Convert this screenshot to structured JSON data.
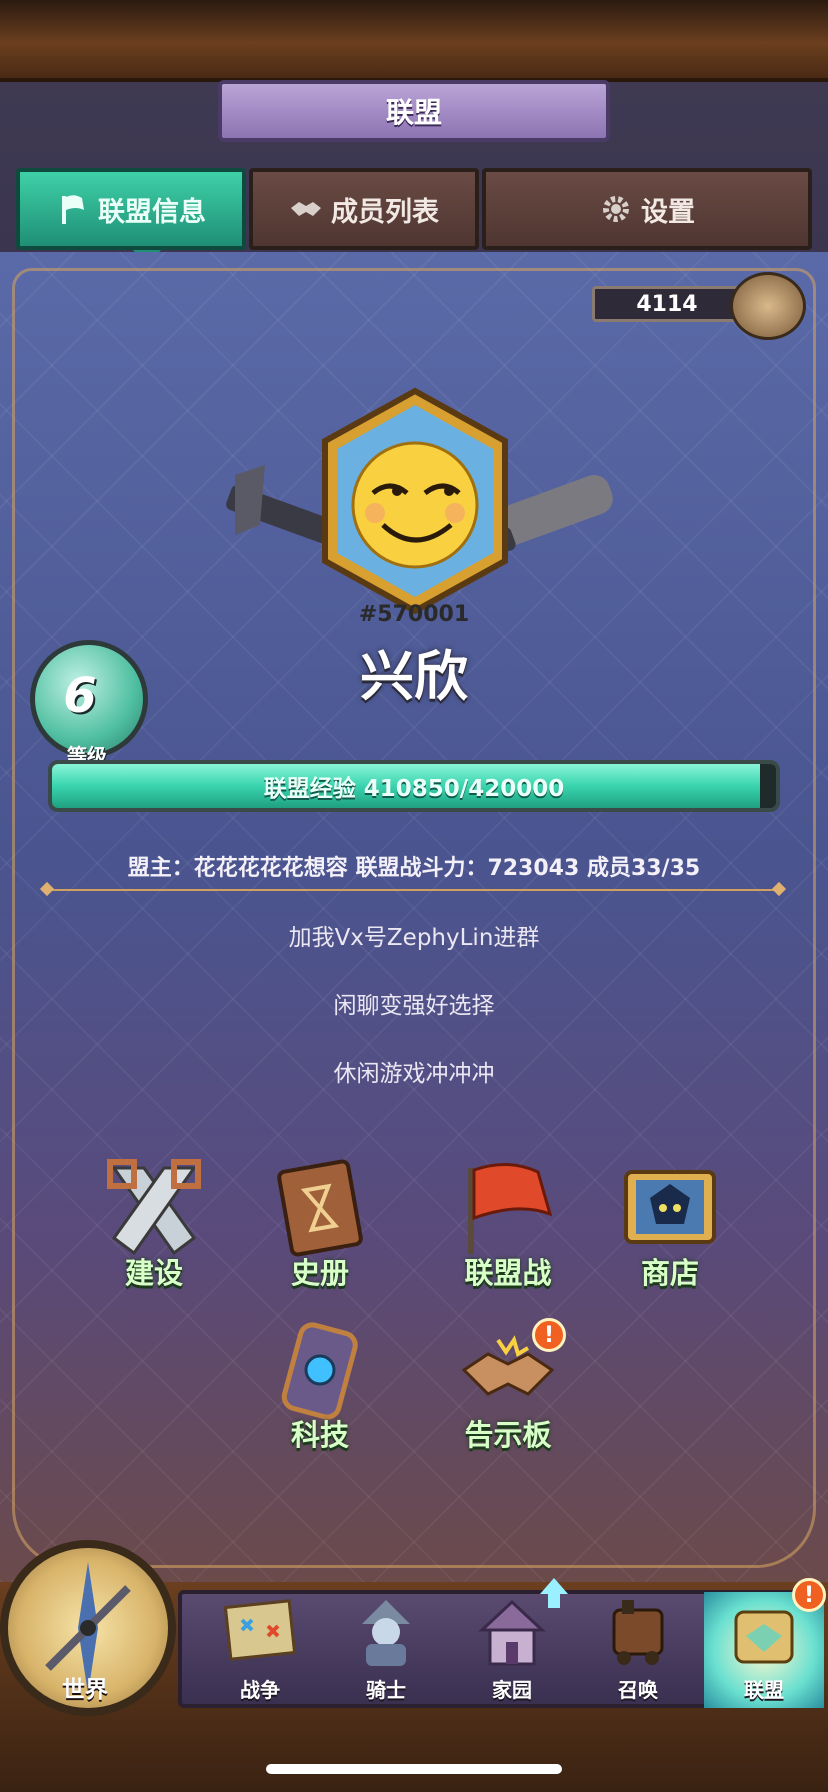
{
  "header": {
    "title": "联盟"
  },
  "tabs": [
    {
      "label": "联盟信息",
      "icon": "flag-icon",
      "active": true
    },
    {
      "label": "成员列表",
      "icon": "handshake-icon",
      "active": false
    },
    {
      "label": "设置",
      "icon": "gear-icon",
      "active": false
    }
  ],
  "alliance": {
    "power_badge_value": "4114",
    "id": "#570001",
    "name": "兴欣",
    "level": "6",
    "level_label": "等级",
    "exp_text": "联盟经验 410850/420000",
    "exp_fraction": 0.9782,
    "info_line": "盟主：花花花花花想容  联盟战斗力：723043 成员33/35",
    "notices": [
      "加我Vx号ZephyLin进群",
      "闲聊变强好选择",
      "休闲游戏冲冲冲"
    ]
  },
  "features": [
    {
      "label": "建设",
      "icon": "saw-icon",
      "alert": false
    },
    {
      "label": "史册",
      "icon": "book-icon",
      "alert": false
    },
    {
      "label": "联盟战",
      "icon": "red-flag-icon",
      "alert": false
    },
    {
      "label": "商店",
      "icon": "shop-icon",
      "alert": false
    },
    {
      "label": "科技",
      "icon": "tech-icon",
      "alert": false
    },
    {
      "label": "告示板",
      "icon": "handshake-board-icon",
      "alert": true,
      "alert_text": "!"
    }
  ],
  "bottom_nav": {
    "world": "世界",
    "items": [
      {
        "label": "战争",
        "icon": "map-icon"
      },
      {
        "label": "骑士",
        "icon": "knight-icon"
      },
      {
        "label": "家园",
        "icon": "house-icon"
      },
      {
        "label": "召唤",
        "icon": "train-icon"
      },
      {
        "label": "联盟",
        "icon": "alliance-icon",
        "active": true,
        "alert_text": "!"
      }
    ]
  },
  "colors": {
    "accent_green": "#39d4ae",
    "alert_orange": "#f06020",
    "frame_gold": "#d0a060"
  }
}
